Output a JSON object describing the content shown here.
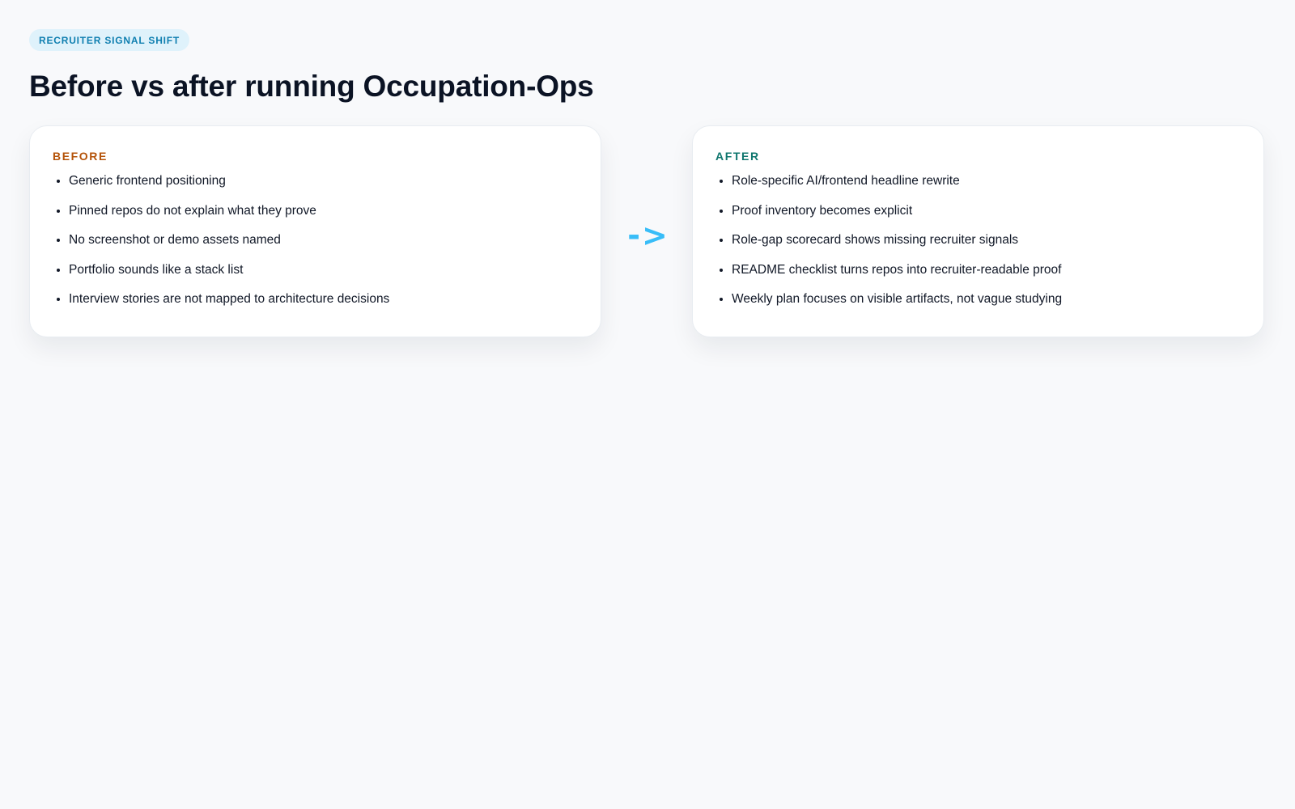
{
  "header": {
    "eyebrow": "RECRUITER SIGNAL SHIFT",
    "title": "Before vs after running Occupation-Ops"
  },
  "before": {
    "label": "BEFORE",
    "items": [
      "Generic frontend positioning",
      "Pinned repos do not explain what they prove",
      "No screenshot or demo assets named",
      "Portfolio sounds like a stack list",
      "Interview stories are not mapped to architecture decisions"
    ]
  },
  "arrow": "->",
  "after": {
    "label": "AFTER",
    "items": [
      "Role-specific AI/frontend headline rewrite",
      "Proof inventory becomes explicit",
      "Role-gap scorecard shows missing recruiter signals",
      "README checklist turns repos into recruiter-readable proof",
      "Weekly plan focuses on visible artifacts, not vague studying"
    ]
  },
  "colors": {
    "eyebrow_bg": "#dff2fb",
    "eyebrow_text": "#0f7fb0",
    "before_accent": "#b45309",
    "after_accent": "#0f766e",
    "arrow": "#38bdf8"
  }
}
